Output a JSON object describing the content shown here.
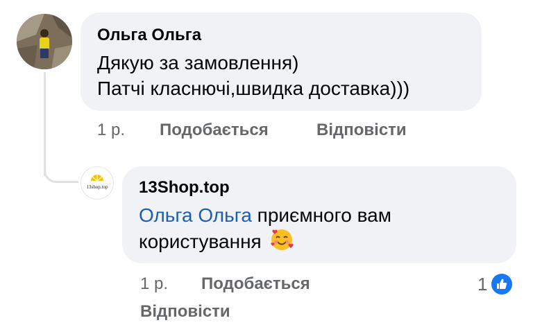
{
  "comment": {
    "author": "Ольга Ольга",
    "lines": [
      "Дякую за замовлення)",
      "Патчі класнючі,швидка доставка)))"
    ],
    "time": "1 р.",
    "like_label": "Подобається",
    "reply_label": "Відповісти",
    "avatar_icon": "user-photo-avatar"
  },
  "reply": {
    "author": "13Shop.top",
    "mention": "Ольга Ольга",
    "text_line1": " приємного вам",
    "text_line2": "користування",
    "emoji_icon": "smiling-face-with-hearts-icon",
    "time": "1 р.",
    "like_label": "Подобається",
    "reply_label": "Відповісти",
    "reaction_count": "1",
    "reaction_icon": "like-icon",
    "avatar_logo_text": "13shop.top"
  },
  "colors": {
    "bubble": "#f0f2f5",
    "meta_text": "#65676b",
    "mention": "#1a5fb4",
    "like": "#1877f2"
  }
}
